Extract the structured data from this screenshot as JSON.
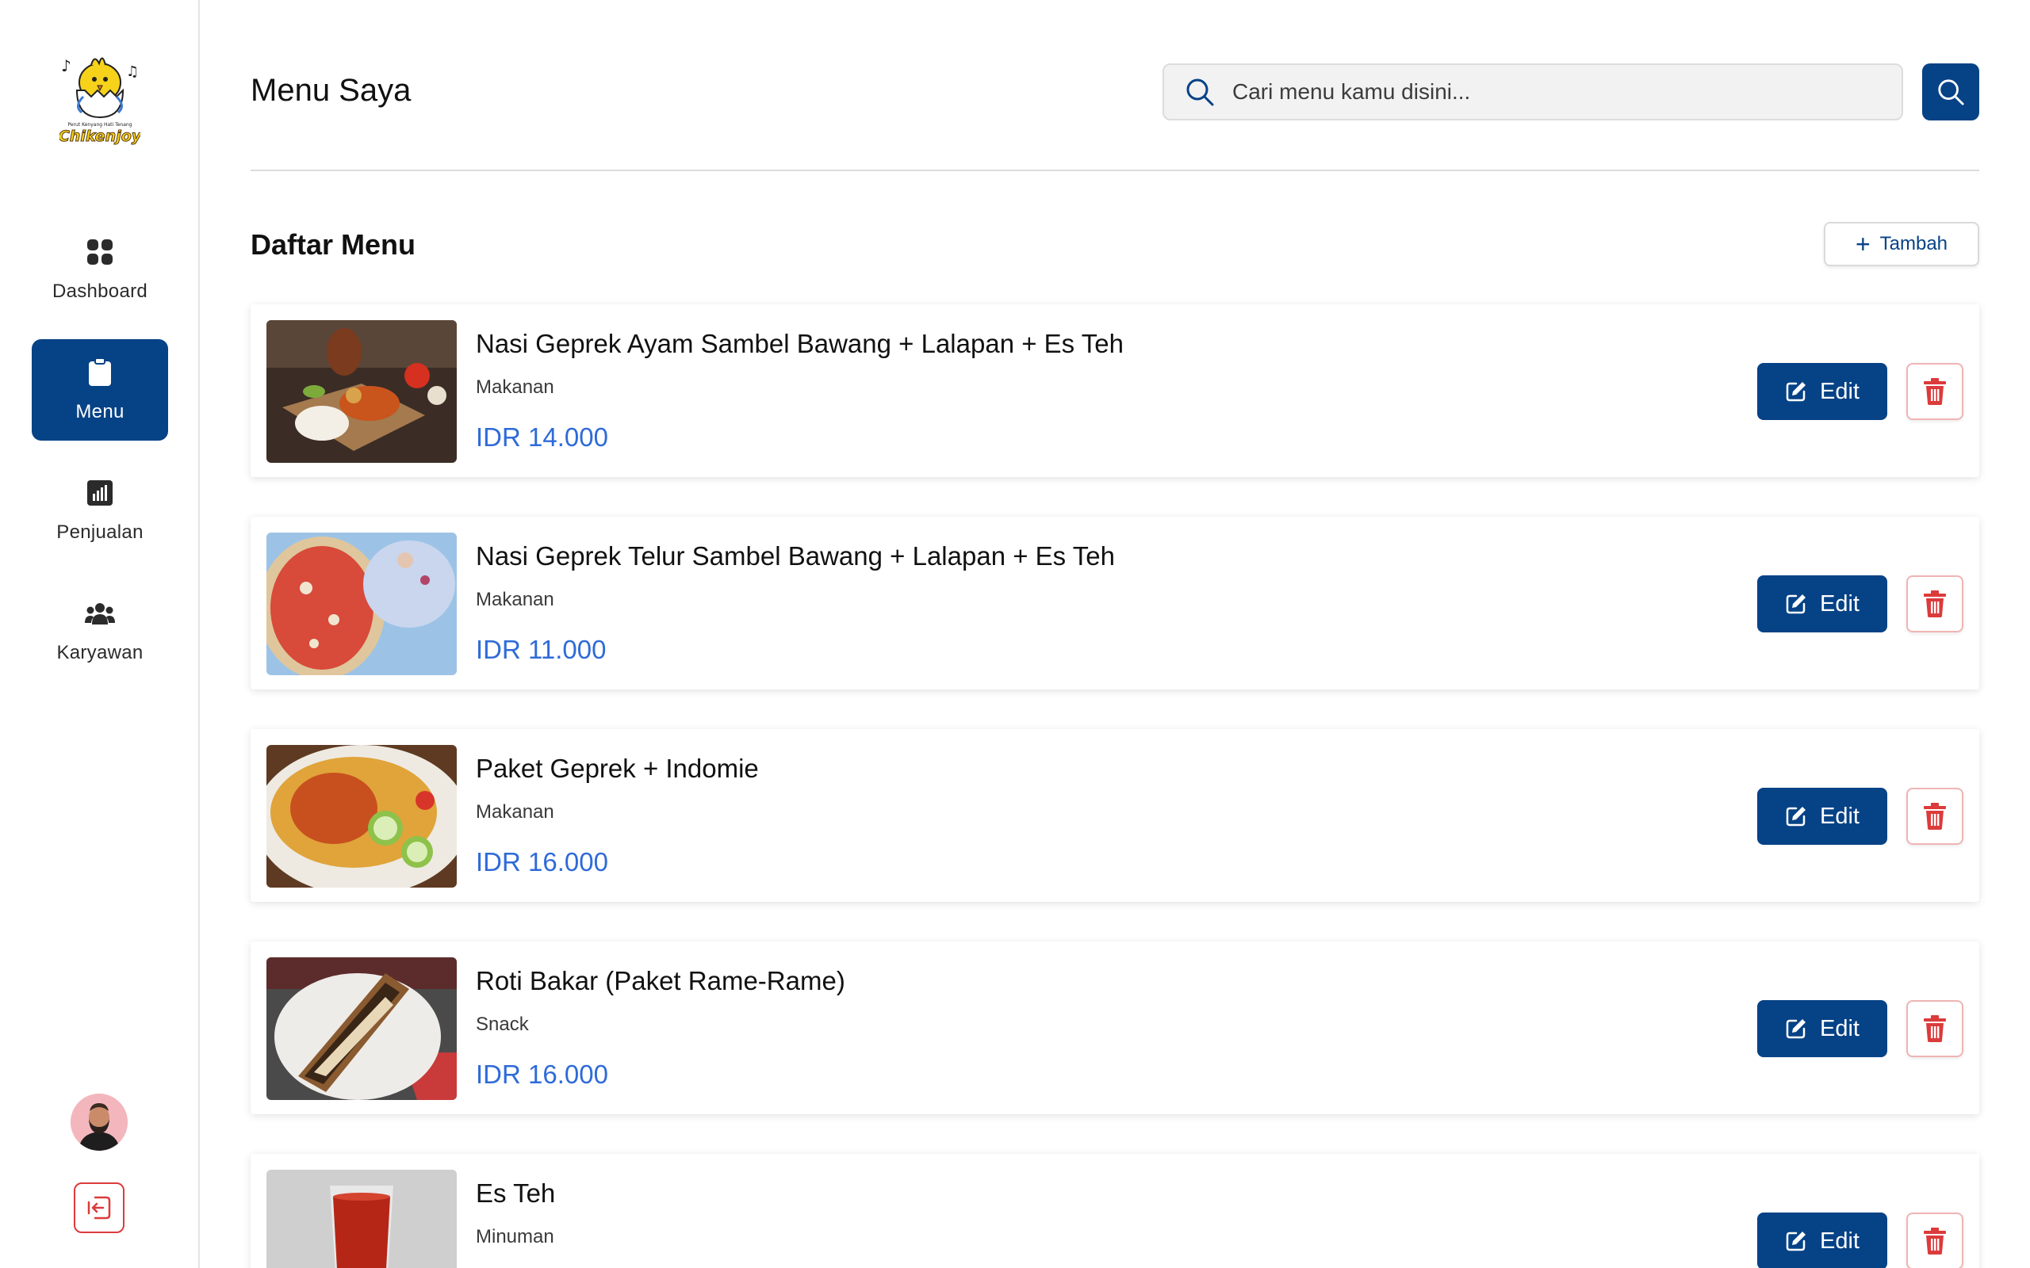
{
  "brand": {
    "name": "Chikenjoy",
    "tagline": "Perut Kenyang Hati Tenang"
  },
  "sidebar": {
    "items": [
      {
        "label": "Dashboard",
        "icon": "dashboard-grid-icon",
        "active": false
      },
      {
        "label": "Menu",
        "icon": "clipboard-icon",
        "active": true
      },
      {
        "label": "Penjualan",
        "icon": "bar-chart-icon",
        "active": false
      },
      {
        "label": "Karyawan",
        "icon": "users-icon",
        "active": false
      }
    ]
  },
  "header": {
    "title": "Menu Saya",
    "search_placeholder": "Cari menu kamu disini..."
  },
  "section": {
    "title": "Daftar Menu",
    "add_label": "Tambah"
  },
  "menu_items": [
    {
      "name": "Nasi Geprek Ayam Sambel Bawang + Lalapan + Es Teh",
      "category": "Makanan",
      "price": "IDR 14.000",
      "edit_label": "Edit"
    },
    {
      "name": "Nasi Geprek Telur Sambel Bawang + Lalapan + Es Teh",
      "category": "Makanan",
      "price": "IDR 11.000",
      "edit_label": "Edit"
    },
    {
      "name": "Paket Geprek + Indomie",
      "category": "Makanan",
      "price": "IDR 16.000",
      "edit_label": "Edit"
    },
    {
      "name": "Roti Bakar (Paket Rame-Rame)",
      "category": "Snack",
      "price": "IDR 16.000",
      "edit_label": "Edit"
    },
    {
      "name": "Es Teh",
      "category": "Minuman",
      "price": "",
      "edit_label": "Edit"
    }
  ],
  "colors": {
    "primary": "#064286",
    "price": "#2f6bd8",
    "danger": "#dc3b3b"
  }
}
